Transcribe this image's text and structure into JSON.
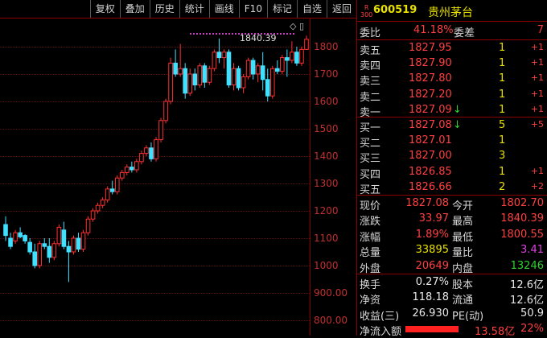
{
  "toolbar": {
    "items": [
      "复权",
      "叠加",
      "历史",
      "统计",
      "画线",
      "F10",
      "标记",
      "自选",
      "返回"
    ]
  },
  "chart": {
    "y_ticks": [
      "1800",
      "1700",
      "1600",
      "1500",
      "1400",
      "1300",
      "1200",
      "1100",
      "1000",
      "900.00",
      "800.00"
    ],
    "peak_label": "1840.39",
    "icons": "◇ ▯"
  },
  "chart_data": {
    "type": "candlestick",
    "ylim": [
      760,
      1870
    ],
    "candles": [
      {
        "o": 1150,
        "h": 1180,
        "l": 1090,
        "c": 1110
      },
      {
        "o": 1100,
        "h": 1120,
        "l": 1060,
        "c": 1070
      },
      {
        "o": 1090,
        "h": 1130,
        "l": 1080,
        "c": 1120
      },
      {
        "o": 1120,
        "h": 1140,
        "l": 1100,
        "c": 1105
      },
      {
        "o": 1110,
        "h": 1115,
        "l": 1080,
        "c": 1090
      },
      {
        "o": 1085,
        "h": 1100,
        "l": 1040,
        "c": 1050
      },
      {
        "o": 1050,
        "h": 1080,
        "l": 990,
        "c": 1000
      },
      {
        "o": 1000,
        "h": 1090,
        "l": 990,
        "c": 1080
      },
      {
        "o": 1080,
        "h": 1100,
        "l": 1060,
        "c": 1070
      },
      {
        "o": 1070,
        "h": 1100,
        "l": 1010,
        "c": 1030
      },
      {
        "o": 1030,
        "h": 1090,
        "l": 1020,
        "c": 1080
      },
      {
        "o": 1080,
        "h": 1150,
        "l": 1070,
        "c": 1140
      },
      {
        "o": 1130,
        "h": 1160,
        "l": 1060,
        "c": 1070
      },
      {
        "o": 1070,
        "h": 1090,
        "l": 940,
        "c": 1050
      },
      {
        "o": 1050,
        "h": 1110,
        "l": 1040,
        "c": 1100
      },
      {
        "o": 1100,
        "h": 1120,
        "l": 1050,
        "c": 1060
      },
      {
        "o": 1060,
        "h": 1130,
        "l": 1050,
        "c": 1120
      },
      {
        "o": 1120,
        "h": 1180,
        "l": 1110,
        "c": 1170
      },
      {
        "o": 1170,
        "h": 1210,
        "l": 1160,
        "c": 1200
      },
      {
        "o": 1200,
        "h": 1230,
        "l": 1190,
        "c": 1220
      },
      {
        "o": 1220,
        "h": 1250,
        "l": 1210,
        "c": 1240
      },
      {
        "o": 1240,
        "h": 1290,
        "l": 1230,
        "c": 1280
      },
      {
        "o": 1280,
        "h": 1310,
        "l": 1260,
        "c": 1270
      },
      {
        "o": 1270,
        "h": 1330,
        "l": 1260,
        "c": 1320
      },
      {
        "o": 1320,
        "h": 1350,
        "l": 1310,
        "c": 1340
      },
      {
        "o": 1340,
        "h": 1370,
        "l": 1330,
        "c": 1360
      },
      {
        "o": 1360,
        "h": 1380,
        "l": 1340,
        "c": 1350
      },
      {
        "o": 1350,
        "h": 1390,
        "l": 1340,
        "c": 1380
      },
      {
        "o": 1380,
        "h": 1420,
        "l": 1370,
        "c": 1410
      },
      {
        "o": 1410,
        "h": 1440,
        "l": 1400,
        "c": 1430
      },
      {
        "o": 1430,
        "h": 1450,
        "l": 1380,
        "c": 1390
      },
      {
        "o": 1390,
        "h": 1470,
        "l": 1380,
        "c": 1460
      },
      {
        "o": 1460,
        "h": 1540,
        "l": 1450,
        "c": 1530
      },
      {
        "o": 1530,
        "h": 1610,
        "l": 1520,
        "c": 1600
      },
      {
        "o": 1600,
        "h": 1760,
        "l": 1590,
        "c": 1740
      },
      {
        "o": 1740,
        "h": 1790,
        "l": 1690,
        "c": 1700
      },
      {
        "o": 1700,
        "h": 1810,
        "l": 1690,
        "c": 1720
      },
      {
        "o": 1720,
        "h": 1740,
        "l": 1610,
        "c": 1630
      },
      {
        "o": 1630,
        "h": 1720,
        "l": 1620,
        "c": 1700
      },
      {
        "o": 1700,
        "h": 1720,
        "l": 1640,
        "c": 1660
      },
      {
        "o": 1660,
        "h": 1740,
        "l": 1650,
        "c": 1730
      },
      {
        "o": 1730,
        "h": 1740,
        "l": 1650,
        "c": 1670
      },
      {
        "o": 1670,
        "h": 1730,
        "l": 1660,
        "c": 1720
      },
      {
        "o": 1720,
        "h": 1790,
        "l": 1710,
        "c": 1780
      },
      {
        "o": 1780,
        "h": 1830,
        "l": 1740,
        "c": 1760
      },
      {
        "o": 1760,
        "h": 1790,
        "l": 1720,
        "c": 1780
      },
      {
        "o": 1780,
        "h": 1790,
        "l": 1650,
        "c": 1660
      },
      {
        "o": 1660,
        "h": 1740,
        "l": 1640,
        "c": 1720
      },
      {
        "o": 1720,
        "h": 1730,
        "l": 1640,
        "c": 1650
      },
      {
        "o": 1650,
        "h": 1700,
        "l": 1630,
        "c": 1690
      },
      {
        "o": 1690,
        "h": 1760,
        "l": 1680,
        "c": 1750
      },
      {
        "o": 1750,
        "h": 1760,
        "l": 1680,
        "c": 1700
      },
      {
        "o": 1700,
        "h": 1740,
        "l": 1670,
        "c": 1730
      },
      {
        "o": 1730,
        "h": 1780,
        "l": 1640,
        "c": 1680
      },
      {
        "o": 1680,
        "h": 1720,
        "l": 1600,
        "c": 1620
      },
      {
        "o": 1620,
        "h": 1730,
        "l": 1610,
        "c": 1720
      },
      {
        "o": 1720,
        "h": 1750,
        "l": 1700,
        "c": 1710
      },
      {
        "o": 1710,
        "h": 1770,
        "l": 1700,
        "c": 1760
      },
      {
        "o": 1760,
        "h": 1790,
        "l": 1690,
        "c": 1750
      },
      {
        "o": 1750,
        "h": 1820,
        "l": 1740,
        "c": 1780
      },
      {
        "o": 1780,
        "h": 1800,
        "l": 1730,
        "c": 1740
      },
      {
        "o": 1740,
        "h": 1800,
        "l": 1730,
        "c": 1790
      },
      {
        "o": 1790,
        "h": 1840.39,
        "l": 1790,
        "c": 1827.08
      }
    ]
  },
  "stock": {
    "badge_top": "R",
    "badge_bottom": "300",
    "code": "600519",
    "name": "贵州茅台"
  },
  "weibi": {
    "label": "委比",
    "value": "41.18%",
    "label2": "委差",
    "value2": "7"
  },
  "asks": [
    {
      "label": "卖五",
      "price": "1827.95",
      "arrow": "",
      "vol": "1",
      "chg": "+1"
    },
    {
      "label": "卖四",
      "price": "1827.90",
      "arrow": "",
      "vol": "1",
      "chg": "+1"
    },
    {
      "label": "卖三",
      "price": "1827.80",
      "arrow": "",
      "vol": "1",
      "chg": "+1"
    },
    {
      "label": "卖二",
      "price": "1827.20",
      "arrow": "",
      "vol": "1",
      "chg": "+1"
    },
    {
      "label": "卖一",
      "price": "1827.09",
      "arrow": "↓",
      "vol": "1",
      "chg": "+1"
    }
  ],
  "bids": [
    {
      "label": "买一",
      "price": "1827.08",
      "arrow": "↓",
      "vol": "5",
      "chg": "+5"
    },
    {
      "label": "买二",
      "price": "1827.01",
      "arrow": "",
      "vol": "1",
      "chg": ""
    },
    {
      "label": "买三",
      "price": "1827.00",
      "arrow": "",
      "vol": "3",
      "chg": ""
    },
    {
      "label": "买四",
      "price": "1826.85",
      "arrow": "",
      "vol": "1",
      "chg": "+1"
    },
    {
      "label": "买五",
      "price": "1826.66",
      "arrow": "",
      "vol": "2",
      "chg": "+2"
    }
  ],
  "quote": [
    {
      "l1": "现价",
      "v1": "1827.08",
      "l2": "今开",
      "v2": "1802.70"
    },
    {
      "l1": "涨跌",
      "v1": "33.97",
      "l2": "最高",
      "v2": "1840.39"
    },
    {
      "l1": "涨幅",
      "v1": "1.89%",
      "l2": "最低",
      "v2": "1800.55"
    },
    {
      "l1": "总量",
      "v1": "33895",
      "l2": "量比",
      "v2": "3.41"
    },
    {
      "l1": "外盘",
      "v1": "20649",
      "l2": "内盘",
      "v2": "13246"
    }
  ],
  "stats": [
    {
      "l1": "换手",
      "v1": "0.27%",
      "l2": "股本",
      "v2": "12.6亿"
    },
    {
      "l1": "净资",
      "v1": "118.18",
      "l2": "流通",
      "v2": "12.6亿"
    },
    {
      "l1": "收益(三)",
      "v1": "26.930",
      "l2": "PE(动)",
      "v2": "50.9"
    }
  ],
  "inflow": {
    "label": "净流入额",
    "value": "13.58亿",
    "pct": "22%"
  }
}
